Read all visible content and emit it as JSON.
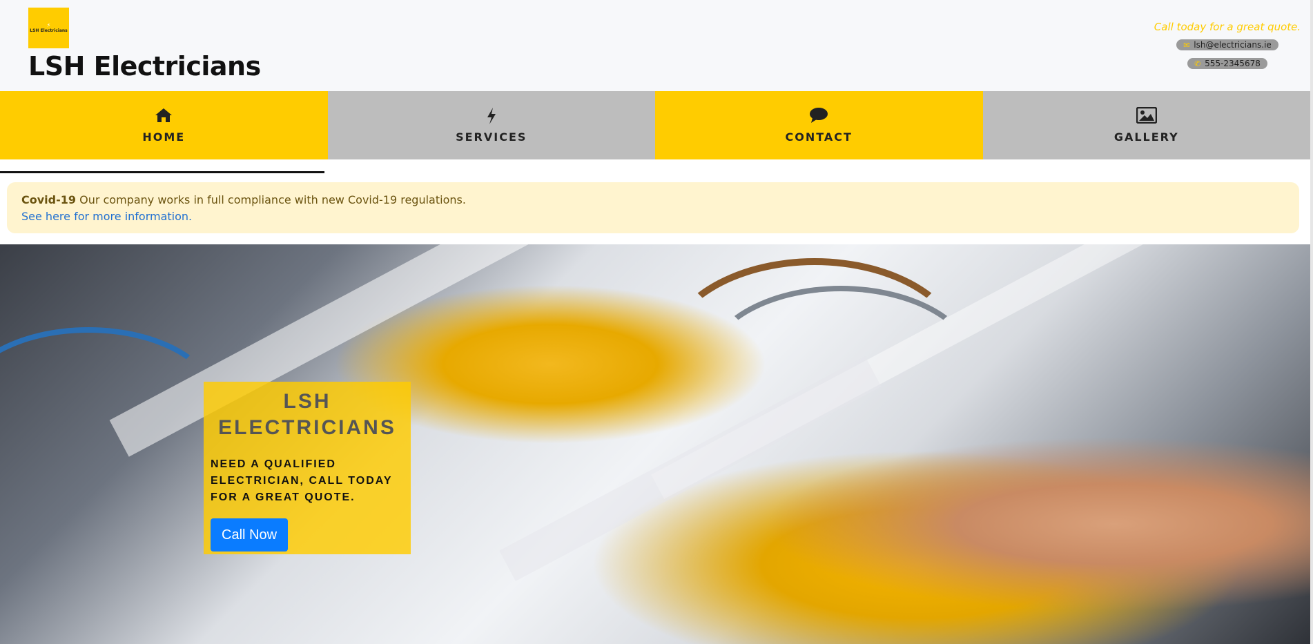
{
  "header": {
    "logo_text": "LSH Electricians",
    "logo_icon": "lightning-bolt-icon",
    "title": "LSH Electricians",
    "tagline": "Call today for a great quote.",
    "email": "lsh@electricians.ie",
    "phone": "555-2345678",
    "email_icon": "envelope-icon",
    "phone_icon": "phone-icon"
  },
  "nav": {
    "items": [
      {
        "label": "HOME",
        "icon": "home-icon"
      },
      {
        "label": "SERVICES",
        "icon": "bolt-icon"
      },
      {
        "label": "CONTACT",
        "icon": "speech-bubble-icon"
      },
      {
        "label": "GALLERY",
        "icon": "picture-icon"
      }
    ]
  },
  "alert": {
    "title": "Covid-19",
    "message": "Our company works in full compliance with new Covid-19 regulations.",
    "link_text": "See here for more information."
  },
  "hero": {
    "title": "LSH ELECTRICIANS",
    "text": "NEED A QUALIFIED ELECTRICIAN, CALL TODAY FOR A GREAT QUOTE.",
    "button_label": "Call Now"
  },
  "colors": {
    "accent": "#ffcc00",
    "nav_grey": "#bdbdbd",
    "alert_bg": "#fff4cf",
    "link": "#1f6fd1",
    "button": "#0a7cff"
  }
}
